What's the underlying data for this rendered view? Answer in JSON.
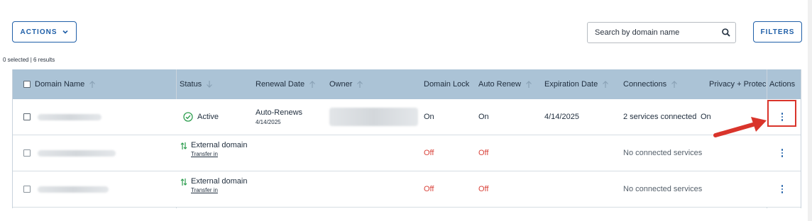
{
  "toolbar": {
    "actions_label": "ACTIONS",
    "search_placeholder": "Search by domain name",
    "filters_label": "FILTERS"
  },
  "result_summary": "0 selected | 6 results",
  "columns": {
    "domain_name": "Domain Name",
    "status": "Status",
    "renewal_date": "Renewal Date",
    "owner": "Owner",
    "domain_lock": "Domain Lock",
    "auto_renew": "Auto Renew",
    "expiration_date": "Expiration Date",
    "connections": "Connections",
    "privacy": "Privacy + Protec",
    "actions": "Actions"
  },
  "rows": [
    {
      "status": "Active",
      "renewal_line1": "Auto-Renews",
      "renewal_line2": "4/14/2025",
      "domain_lock": "On",
      "auto_renew": "On",
      "expiration_date": "4/14/2025",
      "connections": "2 services connected",
      "privacy": "On"
    },
    {
      "status": "External domain",
      "status_link": "Transfer in",
      "domain_lock": "Off",
      "auto_renew": "Off",
      "connections": "No connected services"
    },
    {
      "status": "External domain",
      "status_link": "Transfer in",
      "domain_lock": "Off",
      "auto_renew": "Off",
      "connections": "No connected services"
    }
  ],
  "colors": {
    "accent": "#1f5fa8",
    "header_bg": "#abc3d6",
    "off_red": "#d9423a",
    "active_green": "#2e9e4f",
    "highlight_red": "#d9342b"
  }
}
